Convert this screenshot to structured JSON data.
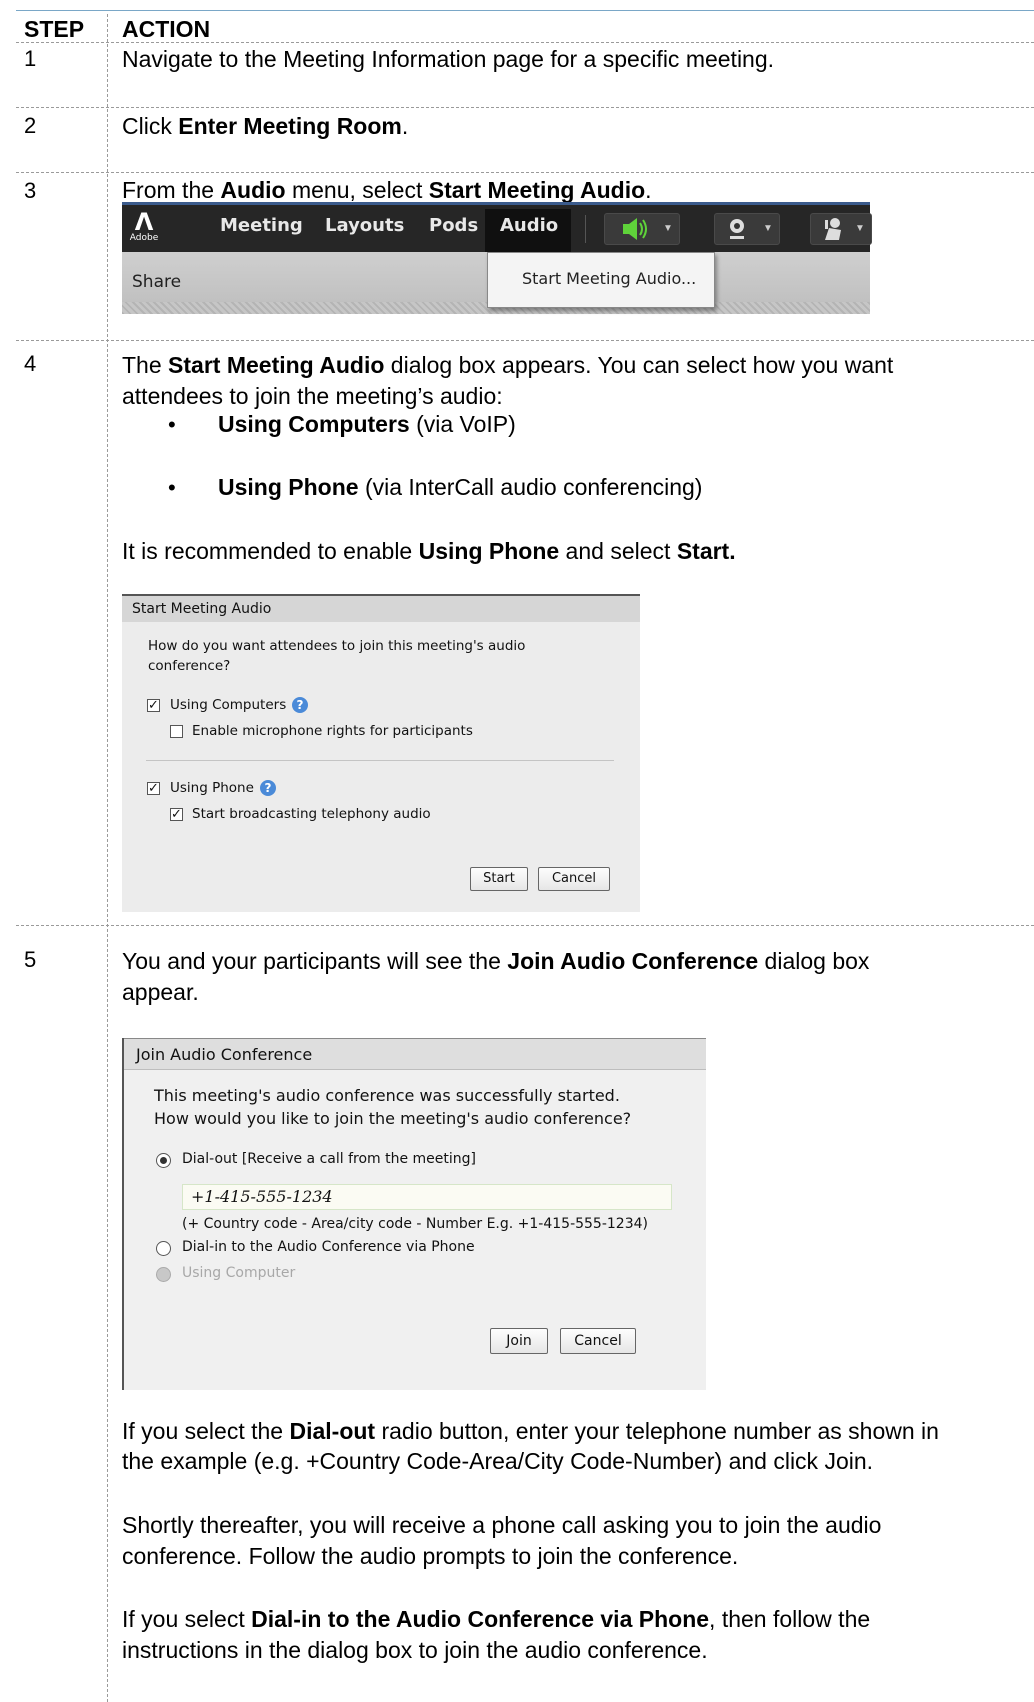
{
  "table": {
    "header_step": "STEP",
    "header_action": "ACTION"
  },
  "steps": {
    "s1": {
      "num": "1",
      "text": "Navigate to the Meeting Information page for a specific meeting."
    },
    "s2": {
      "num": "2",
      "pre": "Click ",
      "bold": "Enter Meeting Room",
      "post": "."
    },
    "s3": {
      "num": "3",
      "pre": "From the ",
      "bold1": "Audio",
      "mid": " menu, select ",
      "bold2": "Start Meeting Audio",
      "post": "."
    },
    "s4": {
      "num": "4",
      "pre": "The ",
      "bold": "Start Meeting Audio",
      "post": " dialog box appears.  You can select how you want",
      "line2": "attendees to join the meeting’s audio:",
      "bullet1_bold": "Using Computers",
      "bullet1_rest": " (via VoIP)",
      "bullet2_bold": "Using Phone",
      "bullet2_rest": " (via InterCall audio conferencing)",
      "rec_pre": "It is recommended to enable ",
      "rec_bold1": "Using Phone",
      "rec_mid": " and select ",
      "rec_bold2": "Start."
    },
    "s5": {
      "num": "5",
      "pre": "You and your participants will see the ",
      "bold": "Join Audio Conference",
      "post": " dialog box",
      "line2": "appear.",
      "p1_pre": "If you select the ",
      "p1_bold": "Dial-out",
      "p1_post": " radio button, enter your telephone number as shown in",
      "p1_line2": "the example (e.g. +Country Code-Area/City Code-Number) and click Join.",
      "p2_line1": "Shortly thereafter, you will receive a phone call asking you to join the audio",
      "p2_line2": "conference.  Follow the audio prompts to join the conference.",
      "p3_pre": "If you select ",
      "p3_bold": "Dial-in to the Audio Conference via Phone",
      "p3_post": ", then follow the",
      "p3_line2": "instructions in the dialog box to join the audio conference."
    }
  },
  "toolbar": {
    "logo": "Adobe",
    "menus": [
      "Meeting",
      "Layouts",
      "Pods",
      "Audio"
    ],
    "share_label": "Share",
    "dropdown_item": "Start Meeting Audio...",
    "speaker_color": "#5fd33a"
  },
  "start_dialog": {
    "title": "Start Meeting Audio",
    "question_line1": "How do you want attendees to join this meeting's audio",
    "question_line2": "conference?",
    "opt_computers": "Using Computers",
    "opt_mic_rights": "Enable microphone rights for participants",
    "opt_phone": "Using Phone",
    "opt_broadcast": "Start broadcasting telephony audio",
    "start_button": "Start",
    "cancel_button": "Cancel"
  },
  "join_dialog": {
    "title": "Join Audio Conference",
    "msg_line1": "This meeting's audio conference was successfully started.",
    "msg_line2": "How would you like to join the meeting's audio conference?",
    "opt_dialout": "Dial-out [Receive a call from the meeting]",
    "phone_value": "+1-415-555-1234",
    "phone_hint": "(+ Country code - Area/city code - Number E.g. +1-415-555-1234)",
    "opt_dialin": "Dial-in to the Audio Conference via Phone",
    "opt_computer": "Using Computer",
    "join_button": "Join",
    "cancel_button": "Cancel"
  }
}
